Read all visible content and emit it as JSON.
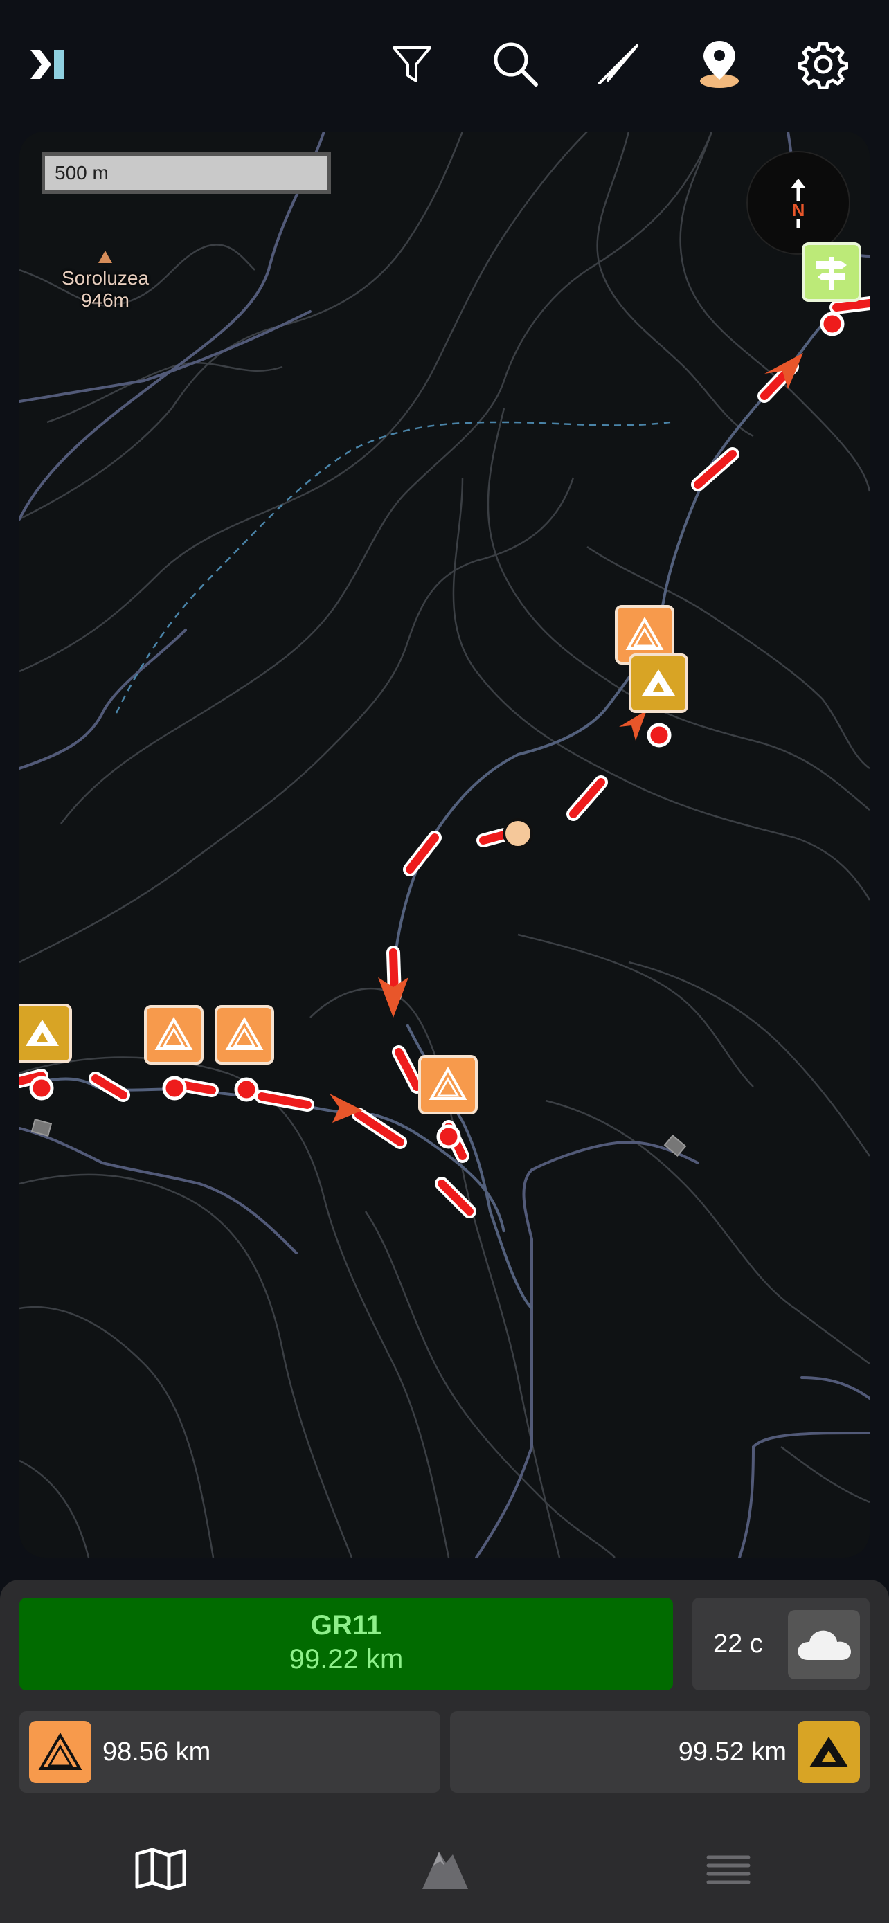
{
  "app": {
    "toolbar": {
      "icons": [
        "logo-icon",
        "filter-icon",
        "search-icon",
        "navigate-icon",
        "location-pin-icon",
        "gear-icon"
      ]
    },
    "map": {
      "scale_label": "500 m",
      "compass_label": "N",
      "peak": {
        "name": "Soroluzea",
        "elevation": "946m"
      }
    },
    "route": {
      "name": "GR11",
      "distance": "99.22 km"
    },
    "weather": {
      "temperature": "22 c",
      "icon": "cloud-icon"
    },
    "waypoints": {
      "previous": {
        "icon": "camp-icon",
        "distance": "98.56 km"
      },
      "next": {
        "icon": "peak-icon",
        "distance": "99.52 km"
      }
    },
    "bottom_nav": [
      "map-icon",
      "mountain-icon",
      "menu-icon"
    ],
    "colors": {
      "route_green": "#016b00",
      "route_text": "#8ef08a",
      "camp_orange": "#f79a4c",
      "peak_gold": "#d8a425",
      "trail_red": "#ee1c1c"
    }
  }
}
